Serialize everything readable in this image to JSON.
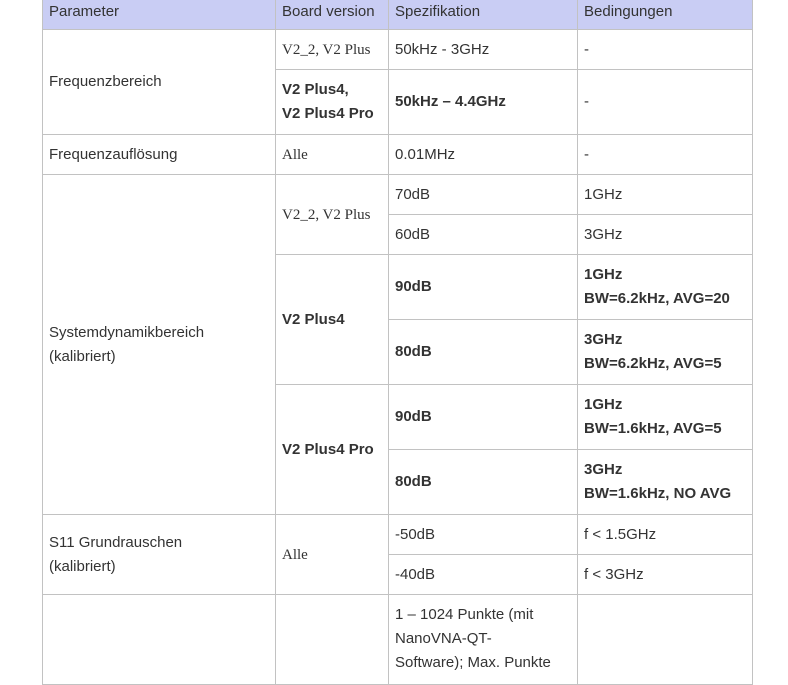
{
  "headers": [
    "Parameter",
    "Board version",
    "Spezifikation",
    "Bedingungen"
  ],
  "rows": {
    "freq": {
      "param": "Frequenzbereich",
      "a_board": "V2_2, V2 Plus",
      "a_spec": "50kHz - 3GHz",
      "a_cond": "-",
      "b_board": "V2 Plus4,\nV2 Plus4 Pro",
      "b_spec": "50kHz – 4.4GHz",
      "b_cond": "-"
    },
    "res": {
      "param": "Frequenzauflösung",
      "board": "Alle",
      "spec": "0.01MHz",
      "cond": "-"
    },
    "dyn": {
      "param": "Systemdynamikbereich\n(kalibriert)",
      "g1_board": "V2_2, V2 Plus",
      "g1_r1_spec": "70dB",
      "g1_r1_cond": "1GHz",
      "g1_r2_spec": "60dB",
      "g1_r2_cond": "3GHz",
      "g2_board": "V2 Plus4",
      "g2_r1_spec": "90dB",
      "g2_r1_cond": "1GHz\nBW=6.2kHz, AVG=20",
      "g2_r2_spec": "80dB",
      "g2_r2_cond": "3GHz\nBW=6.2kHz, AVG=5",
      "g3_board": "V2 Plus4 Pro",
      "g3_r1_spec": "90dB",
      "g3_r1_cond": "1GHz\nBW=1.6kHz, AVG=5",
      "g3_r2_spec": "80dB",
      "g3_r2_cond": "3GHz\nBW=1.6kHz, NO AVG"
    },
    "s11": {
      "param": "S11 Grundrauschen\n(kalibriert)",
      "board": "Alle",
      "r1_spec": "-50dB",
      "r1_cond": "f < 1.5GHz",
      "r2_spec": "-40dB",
      "r2_cond": "f < 3GHz"
    },
    "points": {
      "spec": "1 – 1024 Punkte (mit\nNanoVNA-QT-\nSoftware); Max. Punkte"
    }
  }
}
